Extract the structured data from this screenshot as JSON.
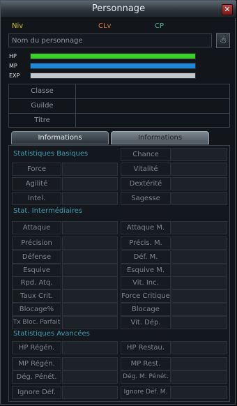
{
  "window": {
    "title": "Personnage",
    "close_icon": "close-icon"
  },
  "header": {
    "niv": "Niv",
    "clv": "CLv",
    "cp": "CP",
    "colors": {
      "niv": "#d8c521",
      "clv": "#e2793b",
      "cp": "#3fb4a3"
    }
  },
  "name_field": {
    "placeholder": "Nom du personnage"
  },
  "bars": [
    {
      "label": "HP",
      "fill": 1.0,
      "color": "#3ad12b"
    },
    {
      "label": "MP",
      "fill": 1.0,
      "color": "#1e88d9"
    },
    {
      "label": "EXP",
      "fill": 1.0,
      "color": "#c3c8cc"
    }
  ],
  "info": {
    "classe": "Classe",
    "guilde": "Guilde",
    "titre": "Titre"
  },
  "tabs": [
    "Informations",
    "Informations supplémentaires"
  ],
  "sections": {
    "basic": "Statistiques Basiques",
    "inter": "Stat. Intermédiaires",
    "adv": "Statistiques Avancées"
  },
  "stats": {
    "chance": "Chance",
    "force": "Force",
    "vitalite": "Vitalité",
    "agilite": "Agilité",
    "dexterite": "Dextérité",
    "intel": "Intel.",
    "sagesse": "Sagesse",
    "attaque": "Attaque",
    "attaque_m": "Attaque M.",
    "precision": "Précision",
    "precis_m": "Précis. M.",
    "defense": "Défense",
    "def_m": "Déf. M.",
    "esquive": "Esquive",
    "esquive_m": "Esquive M.",
    "rpd_atq": "Rpd. Atq.",
    "vit_inc": "Vit. Inc.",
    "taux_crit": "Taux Crit.",
    "force_critique": "Force Critique",
    "blocage_pct": "Blocage%",
    "blocage": "Blocage",
    "tx_bloc": "Tx Bloc. Parfait",
    "vit_dep": "Vit. Dép.",
    "hp_regen": "HP Régén.",
    "hp_restau": "HP Restau.",
    "mp_regen": "MP Régén.",
    "mp_rest": "MP Rest.",
    "deg_penet": "Dég. Pénét.",
    "deg_m_penet": "Dég. M. Pénét.",
    "ignore_def": "Ignore Déf.",
    "ignore_def_m": "Ignore Déf. M."
  }
}
